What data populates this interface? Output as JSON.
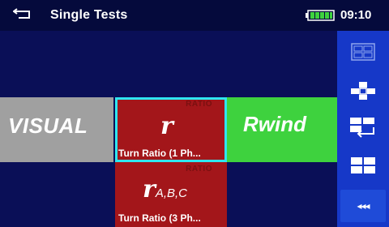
{
  "header": {
    "title": "Single Tests",
    "time": "09:10",
    "icons": [
      "back-arrow-icon",
      "battery-icon"
    ]
  },
  "tiles": [
    {
      "id": "visual",
      "label": "VISUAL",
      "color": "#a0a0a0"
    },
    {
      "id": "r",
      "symbol": "r",
      "tag": "RATIO",
      "caption": "Turn Ratio (1 Ph...",
      "color": "#a3161a",
      "selected": true
    },
    {
      "id": "rwind",
      "label": "Rwind",
      "color": "#3ed23e"
    },
    {
      "id": "rabc",
      "symbol": "r",
      "subscript": "A,B,C",
      "tag": "RATIO",
      "caption": "Turn Ratio (3 Ph...",
      "color": "#a3161a"
    }
  ],
  "toolbar": {
    "buttons": [
      {
        "name": "grid-view-icon"
      },
      {
        "name": "cross-view-icon"
      },
      {
        "name": "swap-view-icon"
      },
      {
        "name": "tile-view-icon"
      },
      {
        "name": "more-icon",
        "label": "◂◂◂"
      }
    ]
  },
  "colors": {
    "background": "#050a3c",
    "main": "#0a0f57",
    "toolbar": "#1638c8",
    "selection": "#2fe6f0"
  }
}
